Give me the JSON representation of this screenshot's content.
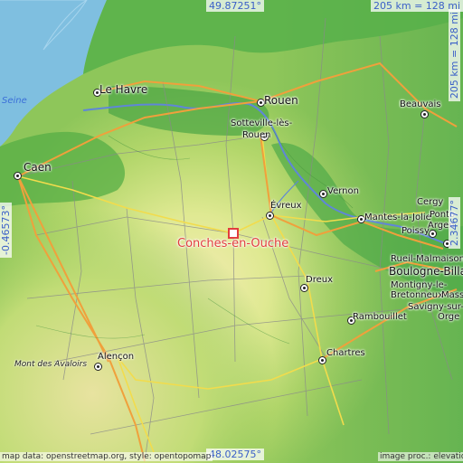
{
  "map": {
    "colors": {
      "sea": "#7fbfe0",
      "lowland": "#4fae45",
      "midland": "#9ccc58",
      "upland": "#d8e88a",
      "highland": "#efe7a8",
      "river": "#5f86d8",
      "highway": "#f0a03c",
      "main_road": "#f2dc4c",
      "road": "#8a8a8a",
      "target": "#e23d3d"
    },
    "target": {
      "label": "Conches-en-Ouche"
    },
    "cities": [
      {
        "name": "Le Havre"
      },
      {
        "name": "Rouen"
      },
      {
        "name": "Sotteville-lès-"
      },
      {
        "name": "Rouen"
      },
      {
        "name": "Beauvais"
      },
      {
        "name": "Caen"
      },
      {
        "name": "Vernon"
      },
      {
        "name": "Évreux"
      },
      {
        "name": "Mantes-la-Jolie"
      },
      {
        "name": "Cergy"
      },
      {
        "name": "Ponto"
      },
      {
        "name": "Argen"
      },
      {
        "name": "Poissy"
      },
      {
        "name": "Rueil-Malmaison"
      },
      {
        "name": "Boulogne-Billa"
      },
      {
        "name": "Dreux"
      },
      {
        "name": "Montigny-le-"
      },
      {
        "name": "Bretonneux"
      },
      {
        "name": "Massy"
      },
      {
        "name": "Savigny-sur-"
      },
      {
        "name": "Orge"
      },
      {
        "name": "Rambouillet"
      },
      {
        "name": "Chartres"
      },
      {
        "name": "Alençon"
      },
      {
        "name": "Mont des Avaloirs"
      }
    ],
    "water_labels": [
      {
        "name": "Seine"
      }
    ],
    "coords": {
      "top": "49.87251°",
      "bottom": "48.02575°",
      "left": "-0.46573°",
      "right": "2.34677°"
    },
    "scale": {
      "horizontal": "205 km = 128 mi",
      "vertical": "205 km = 128 mi"
    },
    "credits": {
      "left": "map data: openstreetmap.org, style: opentopomap",
      "right": "image proc.: elevation.city"
    }
  }
}
